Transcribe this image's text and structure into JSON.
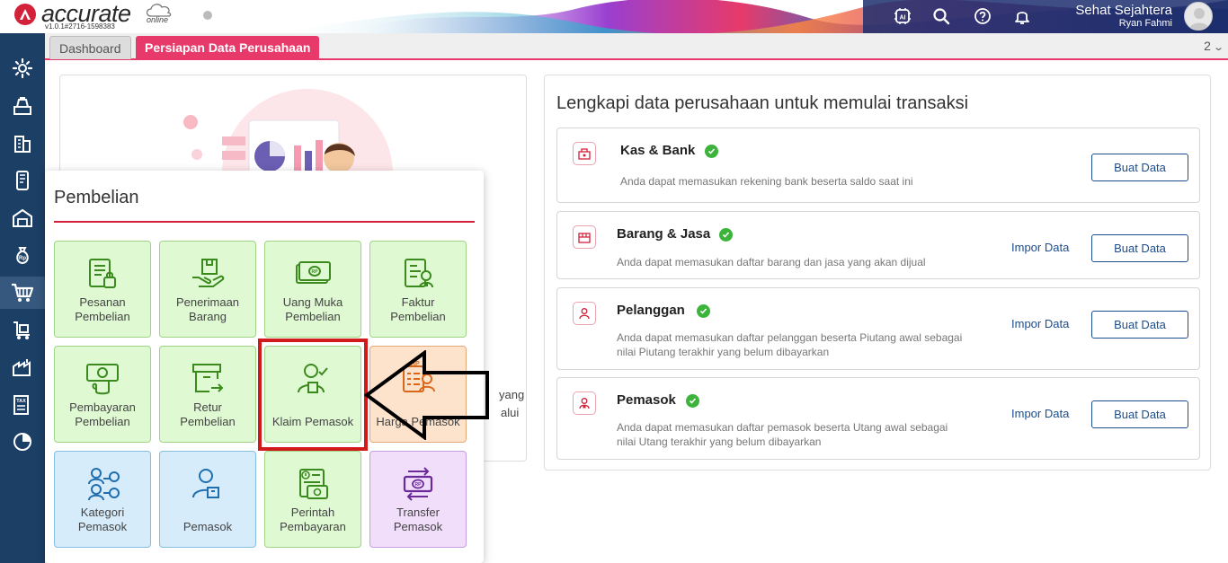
{
  "app": {
    "logo_text": "accurate",
    "logo_sub": "online",
    "version": "v1.0.1#2716-1598383"
  },
  "user": {
    "company": "Sehat Sejahtera",
    "name": "Ryan Fahmi"
  },
  "topbar_icons": [
    "ai-icon",
    "search-icon",
    "help-icon",
    "bell-icon"
  ],
  "sidebar_icons": [
    "settings-icon",
    "cash-register-icon",
    "building-icon",
    "mobile-icon",
    "warehouse-icon",
    "money-bag-icon",
    "cart-icon",
    "inventory-icon",
    "factory-icon",
    "tax-icon",
    "chart-icon"
  ],
  "tabs": [
    {
      "label": "Dashboard"
    },
    {
      "label": "Persiapan Data Perusahaan"
    }
  ],
  "tab_counter": "2",
  "left_card": {
    "frag_1": "yang",
    "frag_2": "alui"
  },
  "main": {
    "title": "Lengkapi data perusahaan untuk memulai transaksi",
    "sections": [
      {
        "title": "Kas & Bank",
        "desc": "Anda dapat memasukan rekening bank beserta saldo saat ini",
        "button": "Buat Data"
      },
      {
        "title": "Barang & Jasa",
        "desc": "Anda dapat memasukan daftar barang dan jasa yang akan dijual",
        "link": "Impor Data",
        "button": "Buat Data"
      },
      {
        "title": "Pelanggan",
        "desc": "Anda dapat memasukan daftar pelanggan beserta Piutang awal sebagai nilai Piutang terakhir yang belum dibayarkan",
        "link": "Impor Data",
        "button": "Buat Data"
      },
      {
        "title": "Pemasok",
        "desc": "Anda dapat memasukan daftar pemasok beserta Utang awal sebagai nilai Utang terakhir yang belum dibayarkan",
        "link": "Impor Data",
        "button": "Buat Data"
      }
    ]
  },
  "popup": {
    "title": "Pembelian",
    "tiles": [
      {
        "label": "Pesanan\nPembelian"
      },
      {
        "label": "Penerimaan\nBarang"
      },
      {
        "label": "Uang Muka\nPembelian"
      },
      {
        "label": "Faktur\nPembelian"
      },
      {
        "label": "Pembayaran\nPembelian"
      },
      {
        "label": "Retur\nPembelian"
      },
      {
        "label": "Klaim Pemasok"
      },
      {
        "label": "Harga Pemasok"
      },
      {
        "label": "Kategori\nPemasok"
      },
      {
        "label": "Pemasok"
      },
      {
        "label": "Perintah\nPembayaran"
      },
      {
        "label": "Transfer\nPemasok"
      }
    ]
  },
  "colors": {
    "sidebar": "#1c3f66",
    "accent": "#e73a6a",
    "brand_red": "#d3213a",
    "link_blue": "#1c4d8c",
    "tile_green": "#dff9d2",
    "tile_orange": "#fde3cc",
    "tile_blue": "#d6ecfb",
    "tile_purple": "#f1defb",
    "highlight": "#d11a1a"
  }
}
